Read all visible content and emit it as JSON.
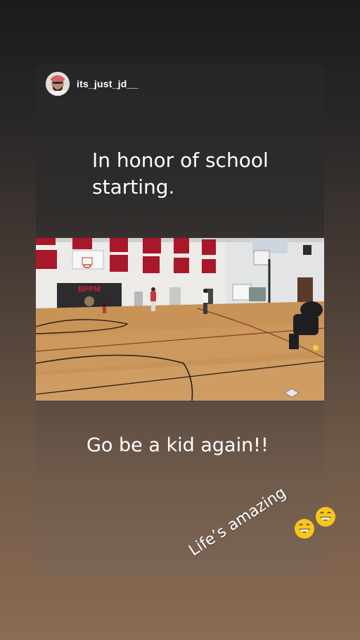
{
  "story": {
    "username": "its_just_jd__",
    "caption_top": "In honor of school starting.",
    "caption_mid": "Go be a kid again!!",
    "sticker_text": "Life’s amazing"
  },
  "photo": {
    "banner_text": "BPPM"
  },
  "icons": {
    "avatar": "profile-avatar",
    "emoji": "grinning-face-emoji"
  }
}
